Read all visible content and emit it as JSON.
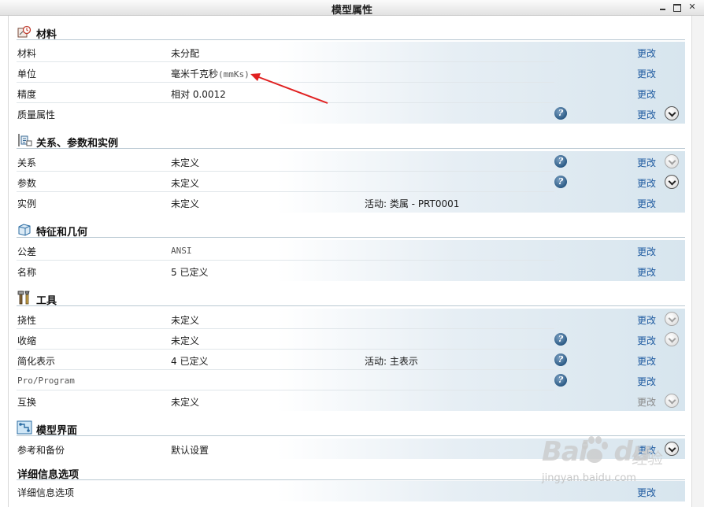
{
  "window": {
    "title": "模型属性"
  },
  "change_label": "更改",
  "sections": {
    "material": {
      "title": "材料"
    },
    "relations": {
      "title": "关系、参数和实例"
    },
    "features": {
      "title": "特征和几何"
    },
    "tools": {
      "title": "工具"
    },
    "interface": {
      "title": "模型界面"
    },
    "detail": {
      "title": "详细信息选项"
    }
  },
  "rows": {
    "material": {
      "label": "材料",
      "value": "未分配"
    },
    "units": {
      "label": "单位",
      "value": "毫米千克秒",
      "value_code": "(mmKs)"
    },
    "accuracy": {
      "label": "精度",
      "value": "相对 0.0012"
    },
    "mass_props": {
      "label": "质量属性"
    },
    "relations": {
      "label": "关系",
      "value": "未定义"
    },
    "parameters": {
      "label": "参数",
      "value": "未定义"
    },
    "instances": {
      "label": "实例",
      "value": "未定义",
      "extra": "活动: 类属 - PRT0001"
    },
    "tolerance": {
      "label": "公差",
      "value": "ANSI"
    },
    "names": {
      "label": "名称",
      "value": "5 已定义"
    },
    "flexibility": {
      "label": "挠性",
      "value": "未定义"
    },
    "shrinkage": {
      "label": "收缩",
      "value": "未定义"
    },
    "simplified_rep": {
      "label": "简化表示",
      "value": "4 已定义",
      "extra": "活动: 主表示"
    },
    "pro_program": {
      "label": "Pro/Program"
    },
    "interchange": {
      "label": "互换",
      "value": "未定义"
    },
    "ref_backup": {
      "label": "参考和备份",
      "value": "默认设置"
    },
    "detail_options": {
      "label": "详细信息选项"
    }
  },
  "icons": {
    "help": "question-icon",
    "expand": "chevron-down-icon"
  },
  "watermark": {
    "logo": "Bai",
    "logo2": "du",
    "sub": "经验",
    "url": "jingyan.baidu.com"
  },
  "colors": {
    "link": "#1e5aa0",
    "disabled_link": "#8a8a8a",
    "annotation_arrow": "#e02020"
  }
}
